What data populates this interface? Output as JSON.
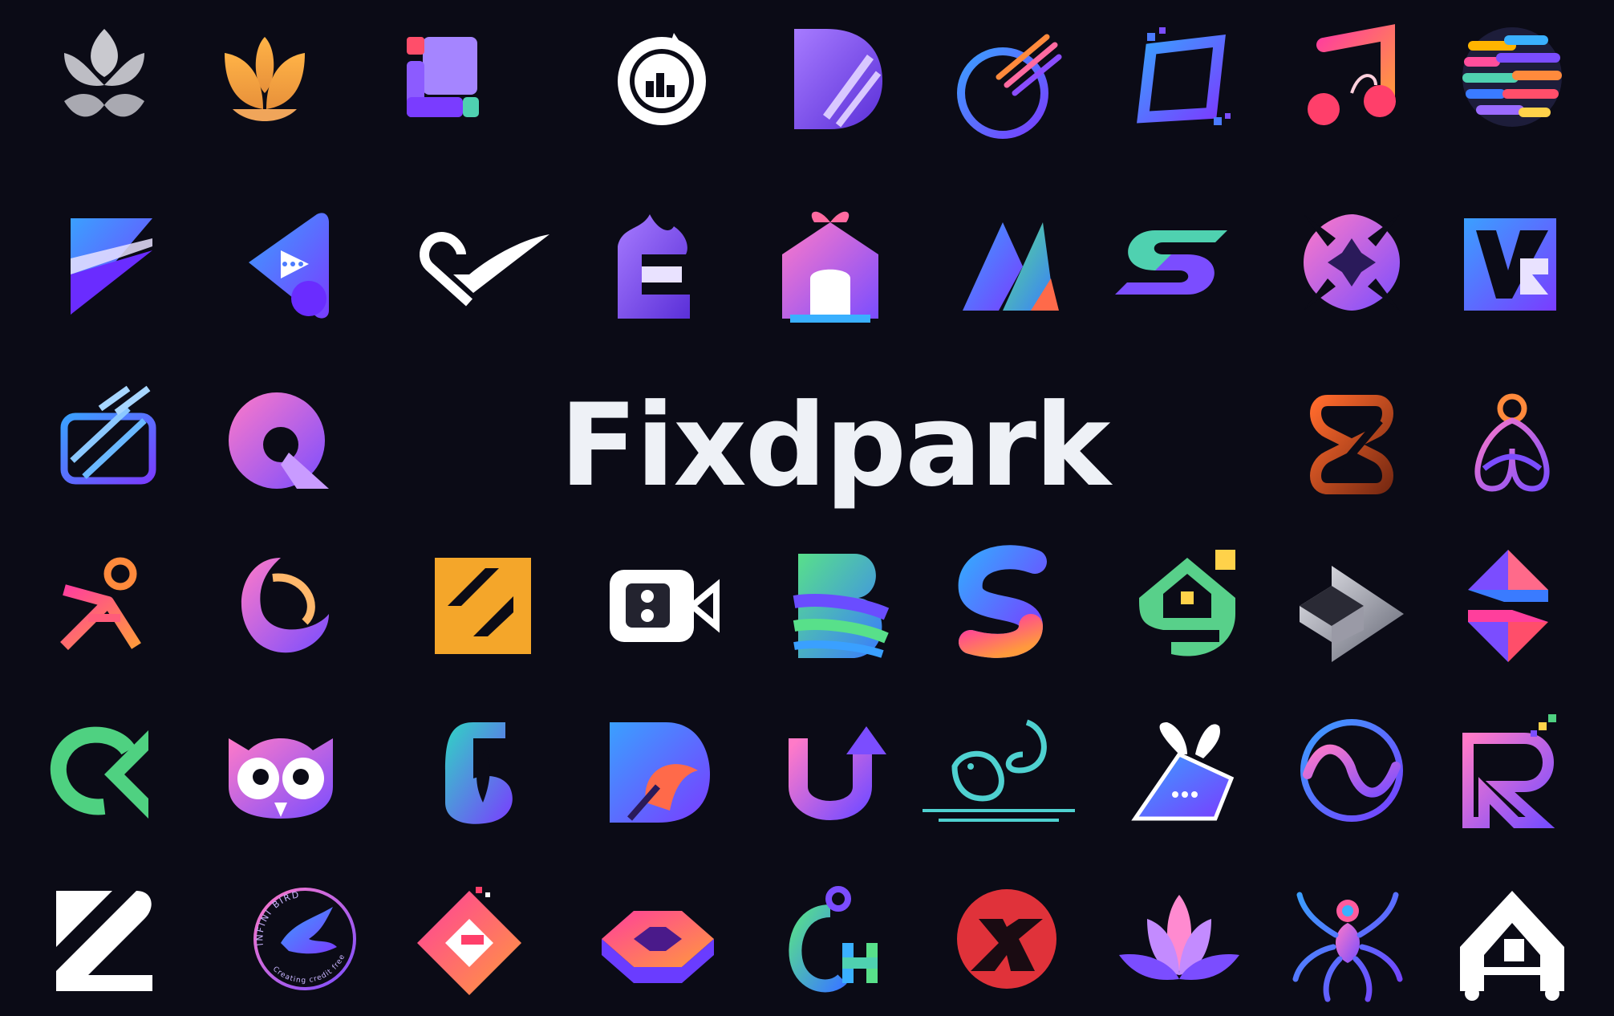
{
  "brand": {
    "name": "Fixdpark"
  },
  "colors": {
    "background": "#0b0b16",
    "brand_text": "#eef1f6",
    "purple": "#7b4dff",
    "blue": "#4b7bff",
    "pink": "#ff5c9e",
    "orange": "#ff8a3c",
    "green": "#4fd181",
    "yellow": "#f4b400"
  },
  "logos": [
    {
      "icon": "lotus-petals-icon"
    },
    {
      "icon": "leaf-sprout-icon"
    },
    {
      "icon": "square-blocks-icon"
    },
    {
      "icon": "chart-circle-icon"
    },
    {
      "icon": "letter-d-stripes-icon"
    },
    {
      "icon": "orbit-ring-icon"
    },
    {
      "icon": "pixel-square-icon"
    },
    {
      "icon": "music-note-icon"
    },
    {
      "icon": "striped-globe-icon"
    },
    {
      "icon": "folded-flag-icon"
    },
    {
      "icon": "play-chat-triangle-icon"
    },
    {
      "icon": "heart-check-icon"
    },
    {
      "icon": "letter-e-flame-icon"
    },
    {
      "icon": "gift-house-icon"
    },
    {
      "icon": "twin-peaks-icon"
    },
    {
      "icon": "letter-s-leaf-icon"
    },
    {
      "icon": "four-petal-star-icon"
    },
    {
      "icon": "letter-vs-square-icon"
    },
    {
      "icon": "striped-tv-icon"
    },
    {
      "icon": "letter-q-bubble-icon"
    },
    {
      "icon": "infinity-loop-icon"
    },
    {
      "icon": "trinity-knot-icon"
    },
    {
      "icon": "running-person-icon"
    },
    {
      "icon": "crescent-swirl-icon"
    },
    {
      "icon": "slash-square-icon"
    },
    {
      "icon": "video-camera-icon"
    },
    {
      "icon": "letter-b-layers-icon"
    },
    {
      "icon": "letter-s-gradient-icon"
    },
    {
      "icon": "house-g-icon"
    },
    {
      "icon": "isometric-arrow-icon"
    },
    {
      "icon": "diamond-s-icon"
    },
    {
      "icon": "letter-ok-arrow-icon"
    },
    {
      "icon": "owl-face-icon"
    },
    {
      "icon": "letter-g-seed-icon"
    },
    {
      "icon": "letter-d-pencil-icon"
    },
    {
      "icon": "letter-u-arrow-icon"
    },
    {
      "icon": "squirrel-line-icon"
    },
    {
      "icon": "rabbit-envelope-icon"
    },
    {
      "icon": "wave-circle-icon"
    },
    {
      "icon": "letter-r-pixel-icon"
    },
    {
      "icon": "letter-z-stripes-icon"
    },
    {
      "icon": "infini-bird-emblem-icon",
      "emblem_text": "INFINI BIRD",
      "tagline": "Creating credit freedom"
    },
    {
      "icon": "letter-g-diamond-icon"
    },
    {
      "icon": "hexagon-portal-icon"
    },
    {
      "icon": "letter-ch-pixel-icon"
    },
    {
      "icon": "letter-x-circle-icon"
    },
    {
      "icon": "lotus-flower-icon"
    },
    {
      "icon": "spider-icon"
    },
    {
      "icon": "house-a-icon"
    }
  ]
}
